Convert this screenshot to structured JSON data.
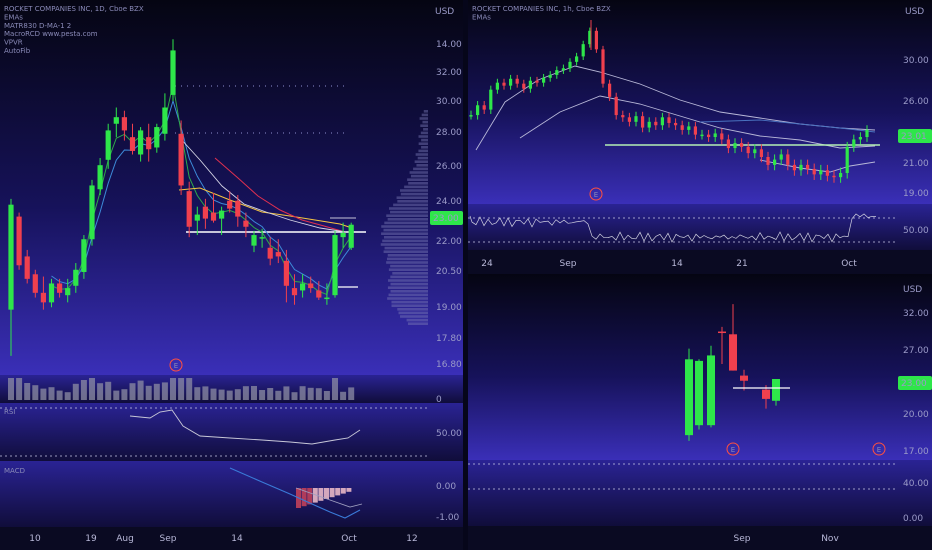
{
  "colors": {
    "up": "#2ee64a",
    "down": "#f0404e",
    "bg_top": "#050512",
    "bg_bottom": "#3a2fb8",
    "price_tag": "#2ee64a",
    "text": "#9a9ac8",
    "earnings": "#ff5040"
  },
  "chart_data": [
    {
      "type": "candlestick",
      "panel": "daily",
      "legend": [
        "ROCKET COMPANIES INC, 1D, Cboe BZX",
        "EMAs",
        "MATR830 D-MA-1 2",
        "MacroRCD www.pesta.com",
        "VPVR",
        "AutoFib"
      ],
      "price_tag": "23.00",
      "currency": "USD",
      "y_ticks": [
        "14.00",
        "32.00",
        "30.00",
        "28.00",
        "26.00",
        "24.00",
        "22.00",
        "20.50",
        "19.00",
        "17.80",
        "16.80"
      ],
      "x_ticks": [
        "10",
        "19",
        "Aug",
        "Sep",
        "14",
        "Oct",
        "12"
      ],
      "earnings_marker": "E",
      "candles": [
        {
          "o": 19.3,
          "h": 24.4,
          "l": 17.5,
          "c": 24.1
        },
        {
          "o": 23.5,
          "h": 23.7,
          "l": 21.0,
          "c": 21.2
        },
        {
          "o": 21.6,
          "h": 21.9,
          "l": 20.4,
          "c": 20.6
        },
        {
          "o": 20.8,
          "h": 21.0,
          "l": 19.8,
          "c": 20.0
        },
        {
          "o": 20.0,
          "h": 20.7,
          "l": 19.3,
          "c": 19.6
        },
        {
          "o": 19.6,
          "h": 20.6,
          "l": 19.4,
          "c": 20.4
        },
        {
          "o": 20.4,
          "h": 20.6,
          "l": 19.8,
          "c": 20.0
        },
        {
          "o": 19.9,
          "h": 20.6,
          "l": 19.6,
          "c": 20.2
        },
        {
          "o": 20.3,
          "h": 21.3,
          "l": 20.0,
          "c": 21.0
        },
        {
          "o": 20.9,
          "h": 22.6,
          "l": 20.6,
          "c": 22.4
        },
        {
          "o": 22.4,
          "h": 25.4,
          "l": 22.1,
          "c": 25.1
        },
        {
          "o": 24.9,
          "h": 26.6,
          "l": 24.6,
          "c": 26.2
        },
        {
          "o": 26.5,
          "h": 28.6,
          "l": 26.0,
          "c": 28.2
        },
        {
          "o": 28.6,
          "h": 29.6,
          "l": 27.8,
          "c": 29.0
        },
        {
          "o": 29.0,
          "h": 29.4,
          "l": 27.6,
          "c": 28.2
        },
        {
          "o": 27.8,
          "h": 28.6,
          "l": 26.8,
          "c": 27.0
        },
        {
          "o": 26.8,
          "h": 28.4,
          "l": 26.4,
          "c": 28.2
        },
        {
          "o": 27.8,
          "h": 28.6,
          "l": 26.4,
          "c": 27.1
        },
        {
          "o": 27.2,
          "h": 28.6,
          "l": 26.9,
          "c": 28.4
        },
        {
          "o": 28.0,
          "h": 30.5,
          "l": 27.6,
          "c": 29.6
        },
        {
          "o": 30.4,
          "h": 34.2,
          "l": 30.0,
          "c": 33.4
        },
        {
          "o": 28.0,
          "h": 28.8,
          "l": 24.6,
          "c": 25.1
        },
        {
          "o": 24.8,
          "h": 25.3,
          "l": 22.5,
          "c": 23.0
        },
        {
          "o": 23.3,
          "h": 24.0,
          "l": 22.6,
          "c": 23.6
        },
        {
          "o": 24.0,
          "h": 24.4,
          "l": 22.9,
          "c": 23.4
        },
        {
          "o": 23.7,
          "h": 24.7,
          "l": 23.2,
          "c": 23.3
        },
        {
          "o": 23.4,
          "h": 24.0,
          "l": 22.6,
          "c": 23.8
        },
        {
          "o": 24.3,
          "h": 24.8,
          "l": 23.7,
          "c": 23.9
        },
        {
          "o": 24.3,
          "h": 24.6,
          "l": 23.0,
          "c": 23.5
        },
        {
          "o": 23.3,
          "h": 23.7,
          "l": 22.5,
          "c": 23.0
        },
        {
          "o": 22.1,
          "h": 22.8,
          "l": 21.8,
          "c": 22.6
        },
        {
          "o": 22.5,
          "h": 22.9,
          "l": 22.0,
          "c": 22.5
        },
        {
          "o": 22.0,
          "h": 22.5,
          "l": 21.2,
          "c": 21.5
        },
        {
          "o": 21.8,
          "h": 22.4,
          "l": 21.3,
          "c": 21.6
        },
        {
          "o": 21.4,
          "h": 21.9,
          "l": 19.6,
          "c": 20.3
        },
        {
          "o": 20.2,
          "h": 20.8,
          "l": 19.5,
          "c": 19.9
        },
        {
          "o": 20.1,
          "h": 20.8,
          "l": 19.8,
          "c": 20.4
        },
        {
          "o": 20.4,
          "h": 20.7,
          "l": 20.0,
          "c": 20.2
        },
        {
          "o": 20.1,
          "h": 20.5,
          "l": 19.7,
          "c": 19.8
        },
        {
          "o": 19.8,
          "h": 20.4,
          "l": 19.5,
          "c": 19.8
        },
        {
          "o": 19.9,
          "h": 22.8,
          "l": 19.8,
          "c": 22.6
        },
        {
          "o": 22.5,
          "h": 23.2,
          "l": 22.0,
          "c": 22.7
        },
        {
          "o": 22.0,
          "h": 23.2,
          "l": 21.9,
          "c": 23.1
        }
      ],
      "sub_panels": [
        {
          "name": "Volume",
          "ticks": [
            "0"
          ]
        },
        {
          "name": "RSI",
          "ticks": [
            "50.00"
          ]
        },
        {
          "name": "MACD",
          "ticks": [
            "0.00",
            "-1.00"
          ]
        }
      ]
    },
    {
      "type": "candlestick",
      "panel": "hourly",
      "legend": [
        "ROCKET COMPANIES INC, 1h, Cboe BZX",
        "EMAs"
      ],
      "price_tag": "23.01",
      "currency": "USD",
      "y_ticks": [
        "30.00",
        "26.00",
        "23.00",
        "21.00",
        "19.00"
      ],
      "x_ticks": [
        "24",
        "Sep",
        "14",
        "21",
        "Oct"
      ],
      "earnings_marker": "E",
      "series_closes": [
        24.5,
        25.4,
        25.0,
        26.9,
        27.6,
        27.3,
        28.0,
        27.5,
        27.0,
        27.8,
        27.6,
        28.1,
        28.4,
        28.9,
        29.1,
        29.8,
        30.4,
        31.8,
        33.4,
        31.2,
        27.5,
        26.2,
        24.5,
        24.3,
        23.9,
        24.4,
        23.4,
        23.9,
        23.6,
        24.3,
        23.8,
        23.6,
        23.2,
        23.5,
        22.8,
        22.8,
        22.6,
        22.9,
        22.4,
        21.7,
        22.1,
        21.8,
        21.3,
        21.6,
        21.0,
        20.4,
        20.8,
        21.2,
        20.4,
        20.0,
        20.4,
        20.1,
        19.7,
        20.0,
        19.6,
        19.5,
        19.8,
        21.8,
        22.4,
        22.6,
        23.2
      ],
      "sub_panels": [
        {
          "name": "RSI",
          "ticks": [
            "50.00"
          ]
        }
      ]
    },
    {
      "type": "candlestick",
      "panel": "weekly",
      "price_tag": "23.00",
      "currency": "USD",
      "y_ticks": [
        "32.00",
        "27.00",
        "20.00",
        "17.00"
      ],
      "x_ticks": [
        "Sep",
        "Nov"
      ],
      "earnings_marker": "E",
      "candles": [
        {
          "o": 18.1,
          "h": 27.6,
          "l": 17.6,
          "c": 26.2
        },
        {
          "o": 19.0,
          "h": 26.2,
          "l": 18.6,
          "c": 26.0
        },
        {
          "o": 19.0,
          "h": 28.0,
          "l": 18.8,
          "c": 26.7
        },
        {
          "o": 30.0,
          "h": 30.7,
          "l": 25.6,
          "c": 29.9
        },
        {
          "o": 29.6,
          "h": 34.3,
          "l": 24.8,
          "c": 24.8
        },
        {
          "o": 24.2,
          "h": 24.9,
          "l": 22.5,
          "c": 23.6
        },
        {
          "o": 22.6,
          "h": 23.1,
          "l": 20.6,
          "c": 21.6
        },
        {
          "o": 21.4,
          "h": 22.5,
          "l": 20.9,
          "c": 23.8
        }
      ],
      "sub_panels": [
        {
          "name": "RSI",
          "ticks": [
            "40.00",
            "0.00"
          ]
        }
      ]
    }
  ]
}
